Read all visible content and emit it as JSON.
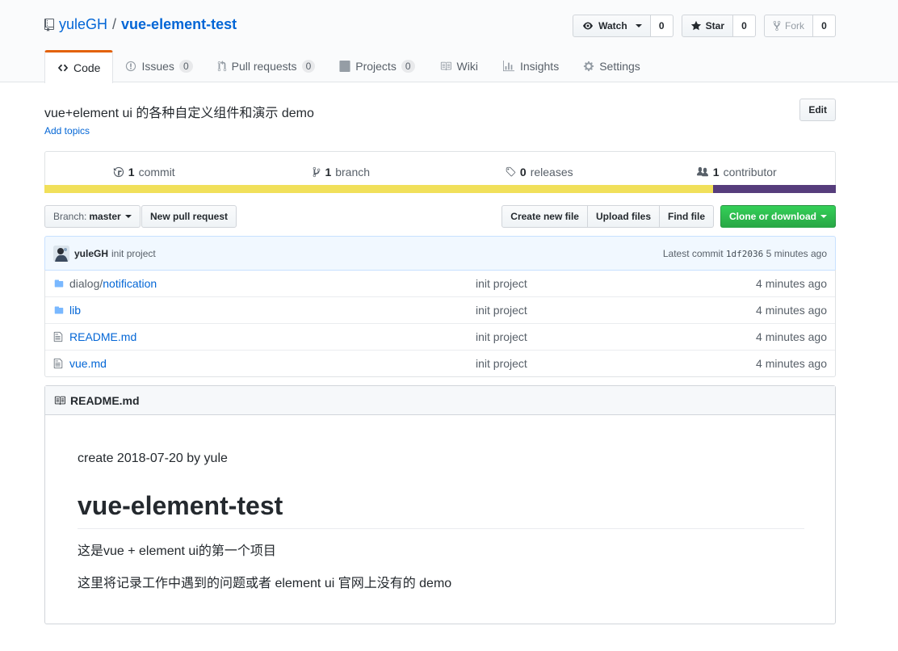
{
  "repo": {
    "owner": "yuleGH",
    "separator": "/",
    "name": "vue-element-test"
  },
  "actions": {
    "watch_label": "Watch",
    "watch_count": "0",
    "star_label": "Star",
    "star_count": "0",
    "fork_label": "Fork",
    "fork_count": "0"
  },
  "nav": {
    "code": "Code",
    "issues": "Issues",
    "issues_count": "0",
    "pulls": "Pull requests",
    "pulls_count": "0",
    "projects": "Projects",
    "projects_count": "0",
    "wiki": "Wiki",
    "insights": "Insights",
    "settings": "Settings"
  },
  "description": "vue+element ui 的各种自定义组件和演示 demo",
  "add_topics": "Add topics",
  "edit_label": "Edit",
  "summary": {
    "commits_num": "1",
    "commits_label": "commit",
    "branches_num": "1",
    "branches_label": "branch",
    "releases_num": "0",
    "releases_label": "releases",
    "contributors_num": "1",
    "contributors_label": "contributor"
  },
  "languages": [
    {
      "color": "#f1e05a",
      "percent": 84.5
    },
    {
      "color": "#563d7c",
      "percent": 15.5
    }
  ],
  "filenav": {
    "branch_prefix": "Branch:",
    "branch_name": "master",
    "new_pr": "New pull request",
    "create_file": "Create new file",
    "upload_files": "Upload files",
    "find_file": "Find file",
    "clone": "Clone or download"
  },
  "latest_commit": {
    "author": "yuleGH",
    "message": "init project",
    "prefix": "Latest commit",
    "sha": "1df2036",
    "age": "5 minutes ago"
  },
  "files": [
    {
      "type": "dir",
      "dim": "dialog/",
      "name": "notification",
      "message": "init project",
      "age": "4 minutes ago"
    },
    {
      "type": "dir",
      "dim": "",
      "name": "lib",
      "message": "init project",
      "age": "4 minutes ago"
    },
    {
      "type": "file",
      "dim": "",
      "name": "README.md",
      "message": "init project",
      "age": "4 minutes ago"
    },
    {
      "type": "file",
      "dim": "",
      "name": "vue.md",
      "message": "init project",
      "age": "4 minutes ago"
    }
  ],
  "readme": {
    "header": "README.md",
    "line1": "create 2018-07-20 by yule",
    "heading": "vue-element-test",
    "para1": "这是vue + element ui的第一个项目",
    "para2": "这里将记录工作中遇到的问题或者 element ui 官网上没有的 demo"
  }
}
